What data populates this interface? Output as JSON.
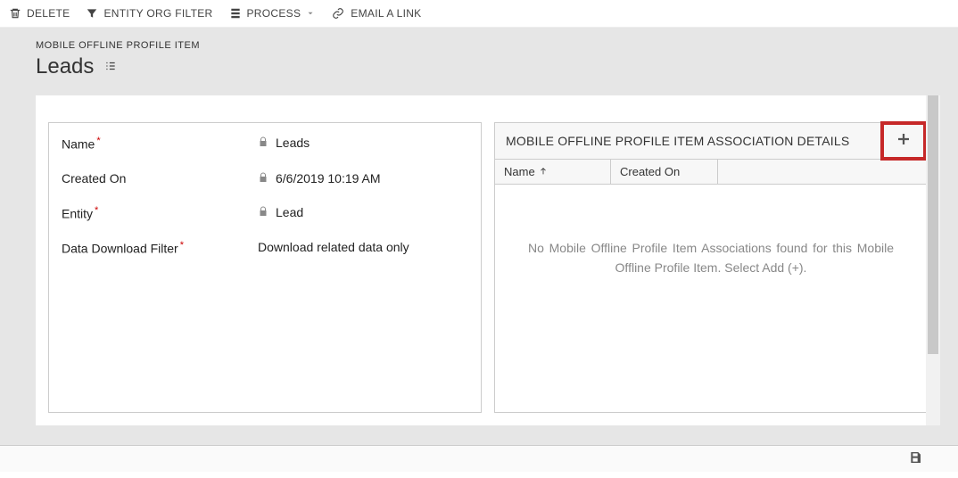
{
  "toolbar": {
    "delete": "DELETE",
    "entityOrgFilter": "ENTITY ORG FILTER",
    "process": "PROCESS",
    "emailLink": "EMAIL A LINK"
  },
  "header": {
    "entityType": "MOBILE OFFLINE PROFILE ITEM",
    "title": "Leads"
  },
  "form": {
    "nameLabel": "Name",
    "nameValue": "Leads",
    "createdOnLabel": "Created On",
    "createdOnValue": "6/6/2019  10:19 AM",
    "entityLabel": "Entity",
    "entityValue": "Lead",
    "dataDownloadLabel": "Data Download Filter",
    "dataDownloadValue": "Download related data only"
  },
  "assocPanel": {
    "title": "MOBILE OFFLINE PROFILE ITEM ASSOCIATION DETAILS",
    "colName": "Name",
    "colCreated": "Created On",
    "emptyMessage": "No Mobile Offline Profile Item Associations found for this Mobile Offline Profile Item. Select Add (+)."
  }
}
